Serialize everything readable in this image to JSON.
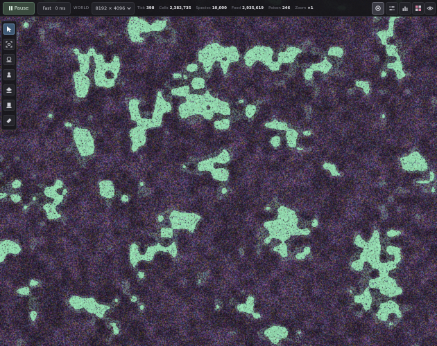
{
  "toolbar": {
    "pause_label": "Pause",
    "speed_label": "Fast",
    "speed_value": "0 ms",
    "world_label": "WORLD",
    "world_size": "8192 × 4096"
  },
  "stats": {
    "tick_label": "Tick",
    "tick_value": "398",
    "cells_label": "Cells",
    "cells_value": "2,382,735",
    "species_label": "Species",
    "species_value": "10,000",
    "food_label": "Food",
    "food_value": "2,935,619",
    "poison_label": "Poison",
    "poison_value": "246",
    "zoom_label": "Zoom",
    "zoom_value": "×1"
  },
  "right_buttons": [
    "settings-icon",
    "sliders-icon",
    "bar-chart-icon",
    "grid-icon",
    "eye-icon"
  ],
  "tools": [
    "cursor-arrow-icon",
    "focus-target-icon",
    "spawn-cell-icon",
    "place-food-icon",
    "place-poison-icon",
    "wall-icon",
    "eraser-icon"
  ],
  "colors": {
    "background": "#1a1620",
    "food_green": "#9be0b4",
    "accent_blue": "#3f5a76",
    "pause_green": "#3a4a3e"
  }
}
